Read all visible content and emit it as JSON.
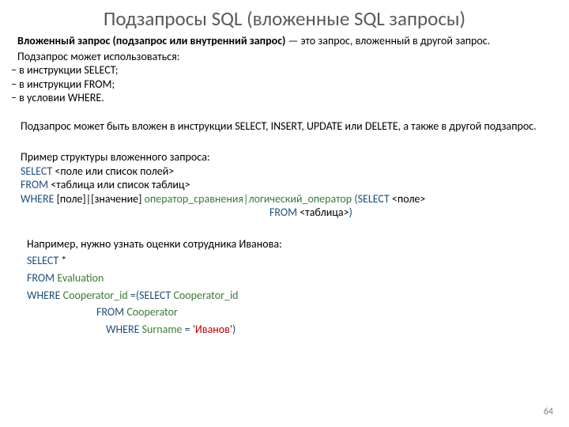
{
  "title": "Подзапросы SQL (вложенные SQL запросы)",
  "intro": {
    "bold": "Вложенный запрос (подзапрос или внутренний запрос)",
    "rest": " — это запрос, вложенный в другой запрос."
  },
  "usage_label": "Подзапрос может использоваться:",
  "bullets": [
    "− в инструкции SELECT;",
    "− в инструкции FROM;",
    "− в условии WHERE."
  ],
  "nested_note": "Подзапрос может быть вложен в инструкции SELECT, INSERT, UPDATE или DELETE, а также в другой подзапрос.",
  "struct": {
    "label": "Пример структуры вложенного запроса:",
    "l1_kw": "SELECT",
    "l1_rest": " <поле или список полей>",
    "l2_kw": "FROM",
    "l2_rest": " <таблица или список таблиц>",
    "l3_kw": "WHERE",
    "l3_mid": " [поле]|[значение] ",
    "l3_green": "оператор_сравнения|логический_оператор",
    "l3_open": " (",
    "l3_select": "SELECT",
    "l3_field": " <поле>",
    "l4_from": "FROM",
    "l4_rest": " <таблица>",
    "l4_close": ")"
  },
  "example2": {
    "label": "Например, нужно узнать оценки сотрудника Иванова:",
    "l1_kw": "SELECT",
    "l1_rest": " *",
    "l2_kw": "FROM ",
    "l2_tbl": "Evaluation",
    "l3_kw": "WHERE ",
    "l3_col": "Cooperator_id ",
    "l3_eq": "=(",
    "l3_sel": "SELECT ",
    "l3_col2": "Cooperator_id",
    "l4_kw": "FROM ",
    "l4_tbl": "Cooperator",
    "l5_kw": "WHERE ",
    "l5_col": "Surname ",
    "l5_eq": "= ",
    "l5_val": "'Иванов'",
    "l5_close": ")"
  },
  "page_num": "64"
}
